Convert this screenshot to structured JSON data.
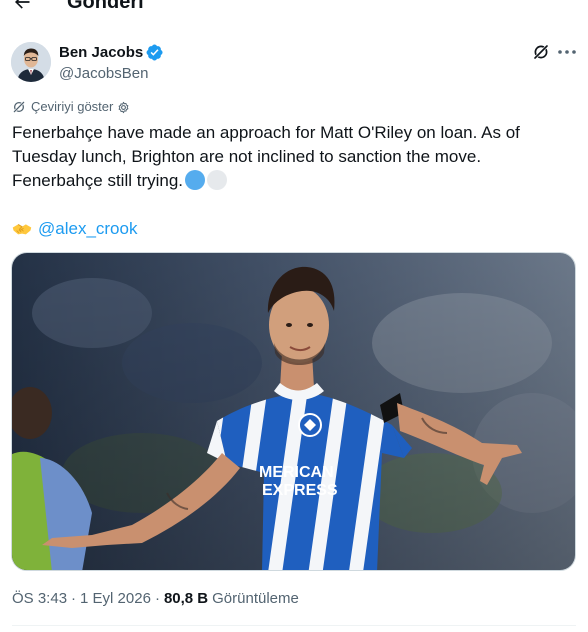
{
  "header": {
    "title": "Gönderi",
    "back_icon": "arrow-left-icon"
  },
  "tweet": {
    "author": {
      "name": "Ben Jacobs",
      "handle": "@JacobsBen",
      "verified": true
    },
    "translate_label": "Çeviriyi göster",
    "text_lines": [
      "Fenerbahçe have made an approach for Matt O'Riley on loan. As of",
      "Tuesday lunch, Brighton are not inclined to sanction the move.",
      "Fenerbahçe still trying."
    ],
    "mention": "@alex_crook",
    "media": {
      "shirt_line1": "MERICAN",
      "shirt_line2": "EXPRESS"
    },
    "meta": {
      "time": "ÖS 3:43",
      "dot": "·",
      "date": "1 Eyl 2026",
      "views": "80,8 B",
      "views_label": "Görüntüleme"
    }
  },
  "colors": {
    "accent": "#1d9bf0",
    "text": "#0f1419",
    "secondary": "#536471",
    "brighton_blue": "#0057b8"
  }
}
